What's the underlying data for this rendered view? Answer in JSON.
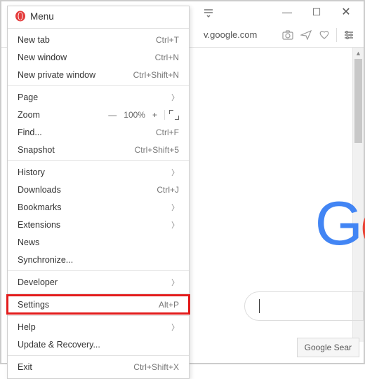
{
  "menu": {
    "title": "Menu",
    "items": {
      "newtab": {
        "label": "New tab",
        "accel": "Ctrl+T"
      },
      "newwin": {
        "label": "New window",
        "accel": "Ctrl+N"
      },
      "newpriv": {
        "label": "New private window",
        "accel": "Ctrl+Shift+N"
      },
      "page": {
        "label": "Page"
      },
      "zoom": {
        "label": "Zoom",
        "value": "100%"
      },
      "find": {
        "label": "Find...",
        "accel": "Ctrl+F"
      },
      "snapshot": {
        "label": "Snapshot",
        "accel": "Ctrl+Shift+5"
      },
      "history": {
        "label": "History"
      },
      "downloads": {
        "label": "Downloads",
        "accel": "Ctrl+J"
      },
      "bookmarks": {
        "label": "Bookmarks"
      },
      "extensions": {
        "label": "Extensions"
      },
      "news": {
        "label": "News"
      },
      "sync": {
        "label": "Synchronize..."
      },
      "developer": {
        "label": "Developer"
      },
      "settings": {
        "label": "Settings",
        "accel": "Alt+P"
      },
      "help": {
        "label": "Help"
      },
      "update": {
        "label": "Update & Recovery..."
      },
      "exit": {
        "label": "Exit",
        "accel": "Ctrl+Shift+X"
      }
    }
  },
  "address": {
    "text": "v.google.com"
  },
  "page": {
    "logo_letters": [
      "G",
      "o"
    ],
    "search_button": "Google Sear"
  },
  "window_controls": {
    "minimize": "—",
    "maximize": "☐",
    "close": "✕"
  }
}
